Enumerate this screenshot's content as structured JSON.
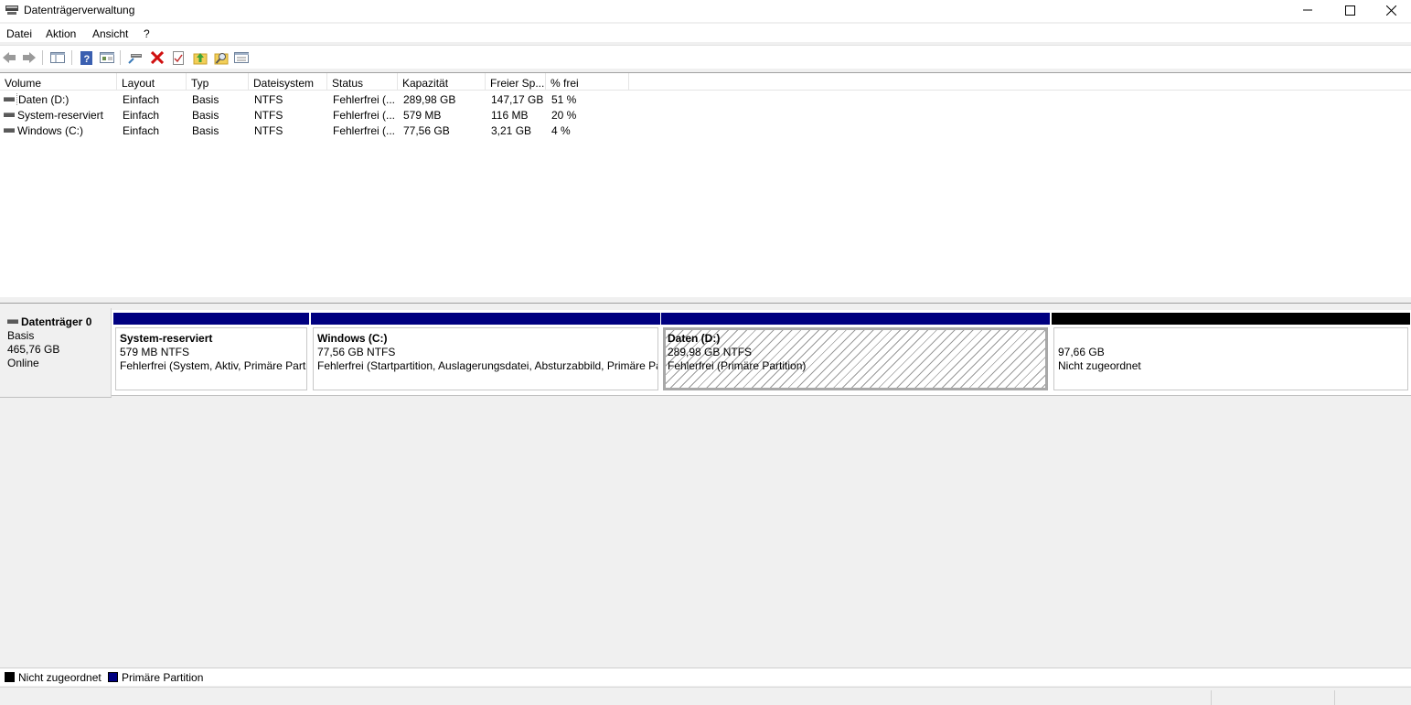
{
  "window": {
    "title": "Datenträgerverwaltung"
  },
  "menu": [
    "Datei",
    "Aktion",
    "Ansicht",
    "?"
  ],
  "toolbar": [
    "back-icon",
    "forward-icon",
    "show-hide-tree-icon",
    "help-icon",
    "properties-icon",
    "connect-icon",
    "delete-icon",
    "check-icon",
    "folder-up-icon",
    "folder-search-icon",
    "console-icon"
  ],
  "volumes": {
    "columns": [
      "Volume",
      "Layout",
      "Typ",
      "Dateisystem",
      "Status",
      "Kapazität",
      "Freier Sp...",
      "% frei"
    ],
    "rows": [
      {
        "volume": "Daten (D:)",
        "layout": "Einfach",
        "typ": "Basis",
        "fs": "NTFS",
        "status": "Fehlerfrei (...",
        "kapazitaet": "289,98 GB",
        "frei": "147,17 GB",
        "prozent": "51 %"
      },
      {
        "volume": "System-reserviert",
        "layout": "Einfach",
        "typ": "Basis",
        "fs": "NTFS",
        "status": "Fehlerfrei (...",
        "kapazitaet": "579 MB",
        "frei": "116 MB",
        "prozent": "20 %"
      },
      {
        "volume": "Windows (C:)",
        "layout": "Einfach",
        "typ": "Basis",
        "fs": "NTFS",
        "status": "Fehlerfrei (...",
        "kapazitaet": "77,56 GB",
        "frei": "3,21 GB",
        "prozent": "4 %"
      }
    ]
  },
  "disk": {
    "name": "Datenträger 0",
    "type": "Basis",
    "size": "465,76 GB",
    "state": "Online",
    "partitions": [
      {
        "name": "System-reserviert",
        "size": "579 MB NTFS",
        "status": "Fehlerfrei (System, Aktiv, Primäre Partition)",
        "bar_color": "#000080"
      },
      {
        "name": "Windows  (C:)",
        "size": "77,56 GB NTFS",
        "status": "Fehlerfrei (Startpartition, Auslagerungsdatei, Absturzabbild, Primäre Partition)",
        "bar_color": "#000080"
      },
      {
        "name": "Daten  (D:)",
        "size": "289,98 GB NTFS",
        "status": "Fehlerfrei (Primäre Partition)",
        "bar_color": "#000080"
      },
      {
        "name": "",
        "size": "97,66 GB",
        "status": "Nicht zugeordnet",
        "bar_color": "#000000"
      }
    ]
  },
  "legend": [
    {
      "label": "Nicht zugeordnet",
      "color": "#000000"
    },
    {
      "label": "Primäre Partition",
      "color": "#000080"
    }
  ]
}
